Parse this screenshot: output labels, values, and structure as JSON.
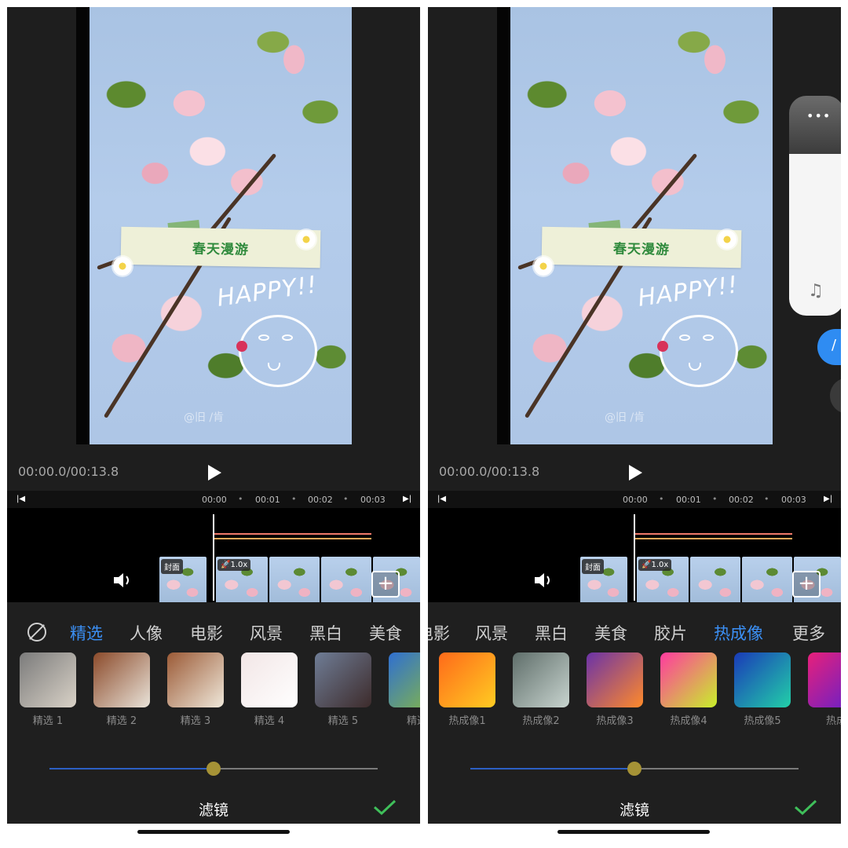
{
  "screens": [
    {
      "id": "left",
      "sticker_text": "春天漫游",
      "sticker_happy": "HAPPY!!",
      "watermark": "@旧 /肯",
      "time": "00:00.0/00:13.8",
      "ruler_ticks": [
        "00:00",
        "00:01",
        "00:02",
        "00:03"
      ],
      "cover_badge": "封面",
      "speed_badge": "🚀1.0x",
      "categories": [
        "精选",
        "人像",
        "电影",
        "风景",
        "黑白",
        "美食"
      ],
      "active_category": "精选",
      "filters": [
        {
          "label": "精选 1",
          "colors": [
            "#7b7b7b",
            "#d9d2c7"
          ]
        },
        {
          "label": "精选 2",
          "colors": [
            "#8b4a2a",
            "#e9e3d9"
          ]
        },
        {
          "label": "精选 3",
          "colors": [
            "#9b5a36",
            "#efe8da"
          ]
        },
        {
          "label": "精选 4",
          "colors": [
            "#f2e6e6",
            "#ffffff"
          ]
        },
        {
          "label": "精选 5",
          "colors": [
            "#6f7d96",
            "#3d2b2b"
          ]
        },
        {
          "label": "精选",
          "colors": [
            "#2f6fd1",
            "#8bbd3c"
          ]
        }
      ],
      "filter_strength": 0.5,
      "panel_title": "滤镜"
    },
    {
      "id": "right",
      "sticker_text": "春天漫游",
      "sticker_happy": "HAPPY!!",
      "watermark": "@旧 /肯",
      "time": "00:00.0/00:13.8",
      "ruler_ticks": [
        "00:00",
        "00:01",
        "00:02",
        "00:03"
      ],
      "cover_badge": "封面",
      "speed_badge": "🚀1.0x",
      "categories": [
        "电影",
        "风景",
        "黑白",
        "美食",
        "胶片",
        "热成像",
        "更多"
      ],
      "active_category": "热成像",
      "filters": [
        {
          "label": "热成像1",
          "colors": [
            "#ff6a1a",
            "#ffcc22"
          ]
        },
        {
          "label": "热成像2",
          "colors": [
            "#5f6e6a",
            "#c8d4cf"
          ]
        },
        {
          "label": "热成像3",
          "colors": [
            "#6a32a8",
            "#ff8a2a"
          ]
        },
        {
          "label": "热成像4",
          "colors": [
            "#ff3aa0",
            "#c8f02a"
          ]
        },
        {
          "label": "热成像5",
          "colors": [
            "#1a3ab8",
            "#22d0a8"
          ]
        },
        {
          "label": "热成",
          "colors": [
            "#e8207a",
            "#5a20d0"
          ]
        }
      ],
      "filter_strength": 0.5,
      "panel_title": "滤镜",
      "side_panel": {
        "dots": "•••",
        "music_icon": "♫",
        "pill_text": "/"
      }
    }
  ],
  "colors": {
    "accent": "#3b8ff4",
    "confirm": "#3fbf5a",
    "audio_lines": [
      "#f07a6a",
      "#f0a85a"
    ]
  }
}
